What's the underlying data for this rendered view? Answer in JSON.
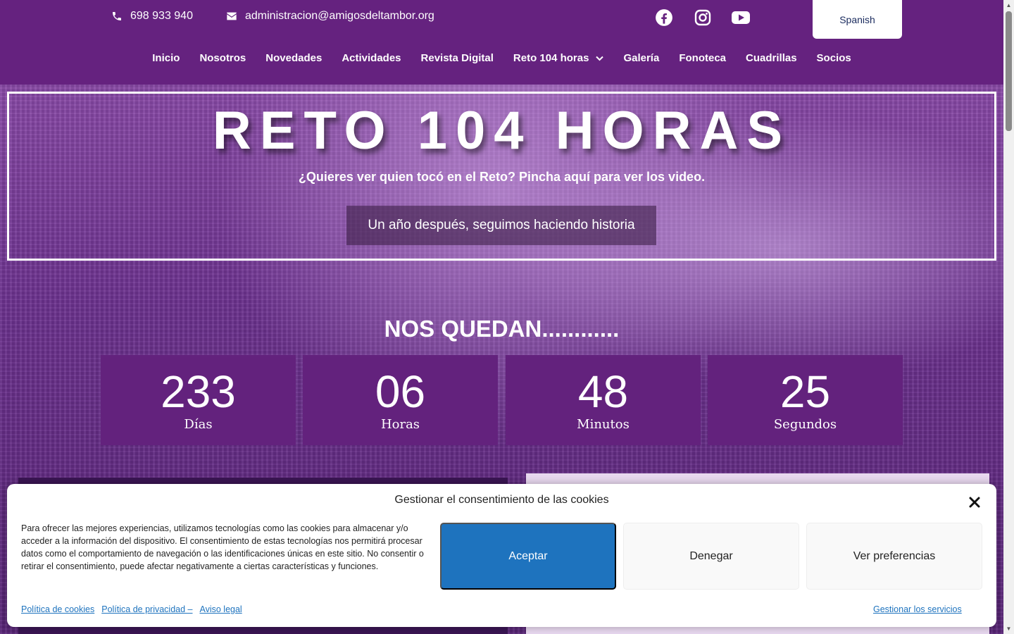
{
  "header": {
    "phone": "698 933 940",
    "email": "administracion@amigosdeltambor.org",
    "language": "Spanish",
    "social_icons": [
      "facebook-icon",
      "instagram-icon",
      "youtube-icon"
    ]
  },
  "nav": {
    "items": [
      {
        "label": "Inicio"
      },
      {
        "label": "Nosotros"
      },
      {
        "label": "Novedades"
      },
      {
        "label": "Actividades"
      },
      {
        "label": "Revista Digital"
      },
      {
        "label": "Reto 104 horas"
      },
      {
        "label": "Galería"
      },
      {
        "label": "Fonoteca"
      },
      {
        "label": "Cuadrillas"
      },
      {
        "label": "Socios"
      }
    ]
  },
  "hero": {
    "title": "RETO 104 HORAS",
    "subtitle": "¿Quieres ver quien tocó en el Reto? Pincha aquí para ver los video.",
    "tagline": "Un año después, seguimos haciendo historia"
  },
  "countdown": {
    "title": "NOS QUEDAN............",
    "units": [
      {
        "value": "233",
        "label": "Días"
      },
      {
        "value": "06",
        "label": "Horas"
      },
      {
        "value": "48",
        "label": "Minutos"
      },
      {
        "value": "25",
        "label": "Segundos"
      }
    ]
  },
  "cookies": {
    "title": "Gestionar el consentimiento de las cookies",
    "text": "Para ofrecer las mejores experiencias, utilizamos tecnologías como las cookies para almacenar y/o acceder a la información del dispositivo. El consentimiento de estas tecnologías nos permitirá procesar datos como el comportamiento de navegación o las identificaciones únicas en este sitio. No consentir o retirar el consentimiento, puede afectar negativamente a ciertas características y funciones.",
    "accept": "Aceptar",
    "deny": "Denegar",
    "preferences": "Ver preferencias",
    "links": [
      "Política de cookies",
      "Política de privacidad –",
      "Aviso legal"
    ],
    "manage": "Gestionar los servicios"
  },
  "colors": {
    "brand_purple": "#65227f",
    "accept_blue": "#1e73be"
  }
}
